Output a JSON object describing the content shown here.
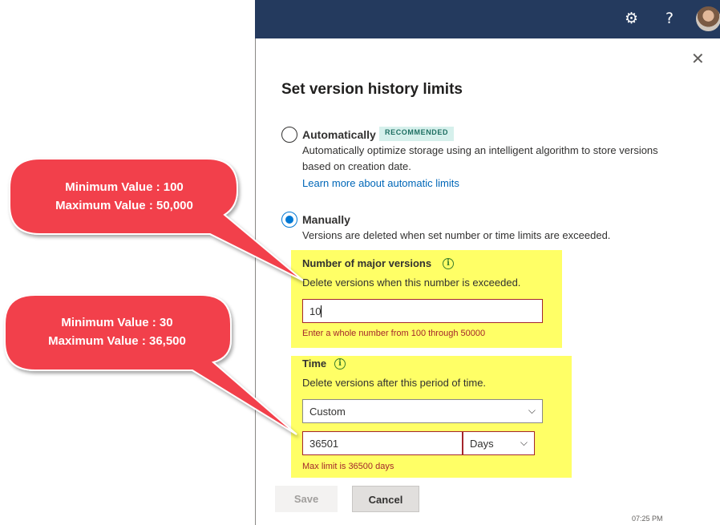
{
  "header": {
    "settings_icon": "gear-icon",
    "help_label": "?",
    "avatar_icon": "user-avatar"
  },
  "dialog": {
    "close_label": "✕",
    "title": "Set version history limits",
    "automatic": {
      "label": "Automatically",
      "badge": "RECOMMENDED",
      "desc_line1": "Automatically optimize storage using an intelligent algorithm to store versions",
      "desc_line2": "based on creation date.",
      "link": "Learn more about automatic limits",
      "selected": false
    },
    "manual": {
      "label": "Manually",
      "desc": "Versions are deleted when set number or time limits are exceeded.",
      "selected": true
    },
    "major_versions": {
      "label": "Number of major versions",
      "help": "Delete versions when this number is exceeded.",
      "value": "10",
      "error": "Enter a whole number from 100 through 50000"
    },
    "time": {
      "label": "Time",
      "help": "Delete versions after this period of time.",
      "period_selected": "Custom",
      "custom_value": "36501",
      "unit_selected": "Days",
      "error": "Max limit is 36500 days"
    },
    "buttons": {
      "save": "Save",
      "cancel": "Cancel"
    },
    "footer_clip": "07:25 PM"
  },
  "callouts": [
    {
      "line1": "Minimum Value : 100",
      "line2": "Maximum Value : 50,000"
    },
    {
      "line1": "Minimum Value : 30",
      "line2": "Maximum Value : 36,500"
    }
  ],
  "colors": {
    "topbar": "#243a5e",
    "accent": "#0078d4",
    "error": "#a4262c",
    "highlight": "#ffff66",
    "callout": "#f2414b"
  }
}
